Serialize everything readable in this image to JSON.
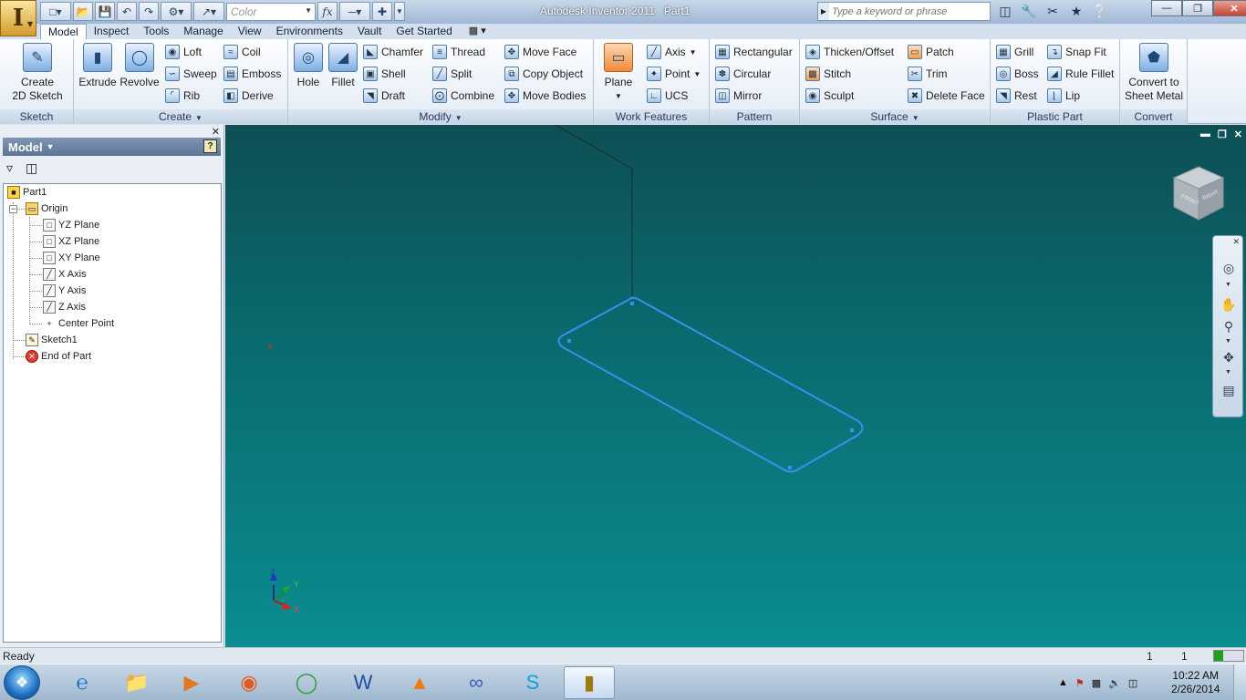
{
  "title": {
    "app": "Autodesk Inventor 2011",
    "doc": "Part1",
    "logo_letter": "I"
  },
  "qat": {
    "color_value": "Color",
    "fx_label": "fx"
  },
  "search": {
    "placeholder": "Type a keyword or phrase"
  },
  "tabs": [
    "Model",
    "Inspect",
    "Tools",
    "Manage",
    "View",
    "Environments",
    "Vault",
    "Get Started"
  ],
  "ribbon": {
    "sketch": {
      "title": "Sketch",
      "create_line1": "Create",
      "create_line2": "2D Sketch"
    },
    "create": {
      "title": "Create",
      "extrude": "Extrude",
      "revolve": "Revolve",
      "loft": "Loft",
      "sweep": "Sweep",
      "rib": "Rib",
      "coil": "Coil",
      "emboss": "Emboss",
      "derive": "Derive"
    },
    "modify": {
      "title": "Modify",
      "hole": "Hole",
      "fillet": "Fillet",
      "chamfer": "Chamfer",
      "shell": "Shell",
      "draft": "Draft",
      "thread": "Thread",
      "split": "Split",
      "combine": "Combine",
      "move_face": "Move Face",
      "copy_object": "Copy Object",
      "move_bodies": "Move Bodies"
    },
    "work": {
      "title": "Work Features",
      "plane": "Plane",
      "axis": "Axis",
      "point": "Point",
      "ucs": "UCS"
    },
    "pattern": {
      "title": "Pattern",
      "rectangular": "Rectangular",
      "circular": "Circular",
      "mirror": "Mirror"
    },
    "surface": {
      "title": "Surface",
      "thicken": "Thicken/Offset",
      "stitch": "Stitch",
      "sculpt": "Sculpt",
      "patch": "Patch",
      "trim": "Trim",
      "delete_face": "Delete Face"
    },
    "plastic": {
      "title": "Plastic Part",
      "grill": "Grill",
      "boss": "Boss",
      "rest": "Rest",
      "snap_fit": "Snap Fit",
      "rule_fillet": "Rule Fillet",
      "lip": "Lip"
    },
    "convert": {
      "title": "Convert",
      "line1": "Convert to",
      "line2": "Sheet Metal"
    }
  },
  "browser": {
    "header": "Model",
    "tree": [
      {
        "label": "Part1"
      },
      {
        "label": "Origin"
      },
      {
        "label": "YZ Plane"
      },
      {
        "label": "XZ Plane"
      },
      {
        "label": "XY Plane"
      },
      {
        "label": "X Axis"
      },
      {
        "label": "Y Axis"
      },
      {
        "label": "Z Axis"
      },
      {
        "label": "Center Point"
      },
      {
        "label": "Sketch1"
      },
      {
        "label": "End of Part"
      }
    ]
  },
  "viewport": {
    "axis_x": "X",
    "axis_y": "Y",
    "axis_z": "Z",
    "viewcube_front": "FRONT",
    "viewcube_right": "RIGHT"
  },
  "status": {
    "text": "Ready",
    "n1": "1",
    "n2": "1"
  },
  "taskbar": {
    "time": "10:22 AM",
    "date": "2/26/2014"
  },
  "colors": {
    "sketch_line": "#3b8ef0",
    "viewport_top": "#0d4f54",
    "viewport_bottom": "#0a8d91",
    "tab_active": "#ffffff"
  }
}
